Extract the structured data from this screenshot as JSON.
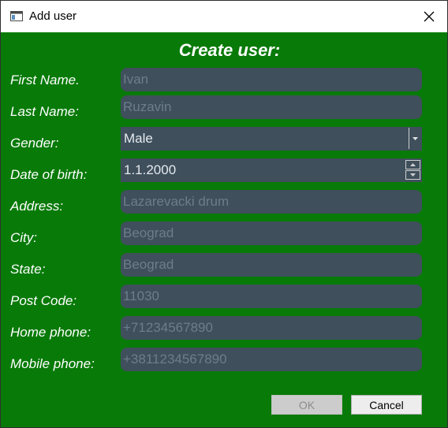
{
  "window": {
    "title": "Add user"
  },
  "form": {
    "heading": "Create user:",
    "labels": {
      "first_name": "First Name.",
      "last_name": "Last Name:",
      "gender": "Gender:",
      "dob": "Date of birth:",
      "address": "Address:",
      "city": "City:",
      "state": "State:",
      "post_code": "Post Code:",
      "home_phone": "Home phone:",
      "mobile_phone": "Mobile phone:"
    },
    "placeholders": {
      "first_name": "Ivan",
      "last_name": "Ruzavin",
      "address": "Lazarevacki drum",
      "city": "Beograd",
      "state": "Beograd",
      "post_code": "11030",
      "home_phone": "+71234567890",
      "mobile_phone": "+3811234567890"
    },
    "gender_value": "Male",
    "dob_value": "1.1.2000"
  },
  "buttons": {
    "ok": "OK",
    "cancel": "Cancel"
  },
  "icons": {
    "app": "window-icon",
    "close": "close-icon",
    "dropdown": "chevron-down-icon",
    "up": "spin-up-icon",
    "down": "spin-down-icon"
  },
  "colors": {
    "background": "#087a08",
    "field": "#3f4f5c",
    "placeholder": "#6c7e8b"
  }
}
